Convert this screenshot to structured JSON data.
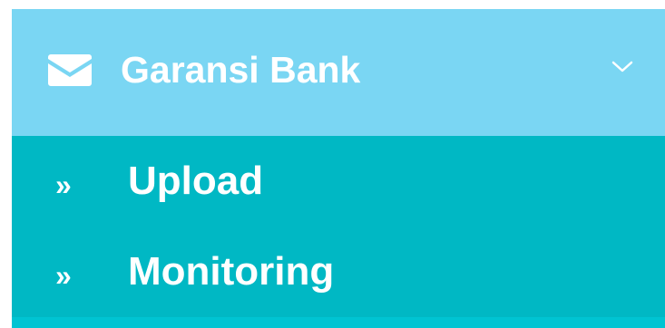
{
  "menu": {
    "title": "Garansi Bank",
    "icon": "envelope-icon",
    "expand_icon": "chevron-down-icon",
    "items": [
      {
        "label": "Upload",
        "bullet": "»",
        "icon": "double-chevron-right-icon"
      },
      {
        "label": "Monitoring",
        "bullet": "»",
        "icon": "double-chevron-right-icon"
      }
    ]
  },
  "colors": {
    "header_bg": "#7ad6f3",
    "submenu_bg": "#00b8c4",
    "text": "#ffffff"
  }
}
